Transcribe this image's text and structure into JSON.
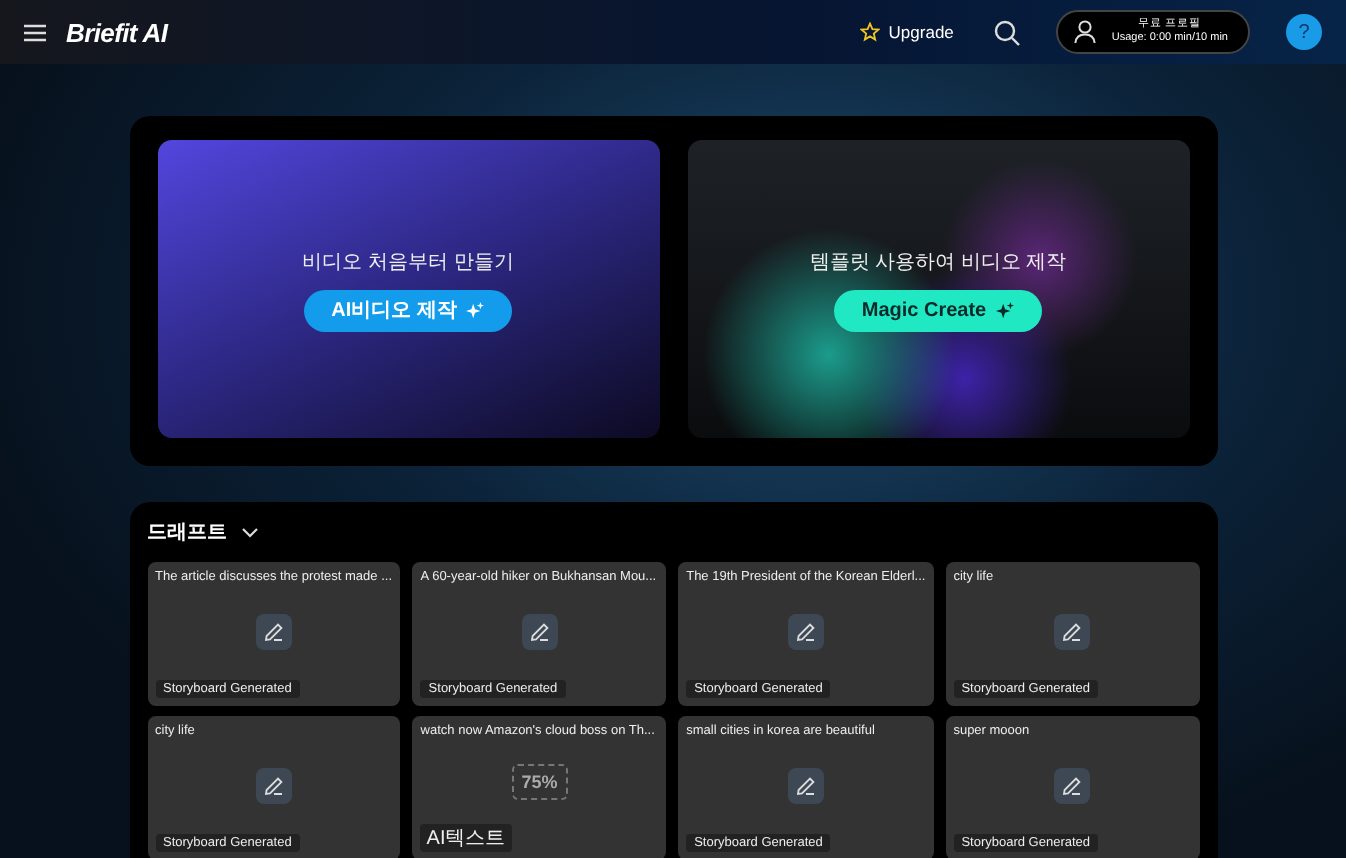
{
  "header": {
    "logo": "Briefit AI",
    "upgrade": "Upgrade",
    "plan": "무료 프로필",
    "usage": "Usage: 0:00 min/10 min",
    "help": "?"
  },
  "hero": [
    {
      "kind": "scratch",
      "caption": "비디오 처음부터 만들기",
      "button": "AI비디오 제작"
    },
    {
      "kind": "template",
      "caption": "템플릿 사용하여 비디오 제작",
      "button": "Magic Create"
    }
  ],
  "drafts": {
    "title": "드래프트",
    "cards": [
      {
        "title": "The article discusses the protest made ...",
        "kind": "edit",
        "badge": "Storyboard Generated"
      },
      {
        "title": "A 60-year-old hiker on Bukhansan Mou...",
        "kind": "edit",
        "badge": "Storyboard Generated"
      },
      {
        "title": "The 19th President of the Korean Elderl...",
        "kind": "edit",
        "badge": "Storyboard Generated"
      },
      {
        "title": "city life",
        "kind": "edit",
        "badge": "Storyboard Generated"
      },
      {
        "title": "city life",
        "kind": "edit",
        "badge": "Storyboard Generated"
      },
      {
        "title": "watch now Amazon's cloud boss on Th...",
        "kind": "progress",
        "progress": "75%",
        "badge": "AI텍스트"
      },
      {
        "title": "small cities in korea are beautiful",
        "kind": "edit",
        "badge": "Storyboard Generated"
      },
      {
        "title": "super mooon",
        "kind": "edit",
        "badge": "Storyboard Generated"
      }
    ]
  }
}
